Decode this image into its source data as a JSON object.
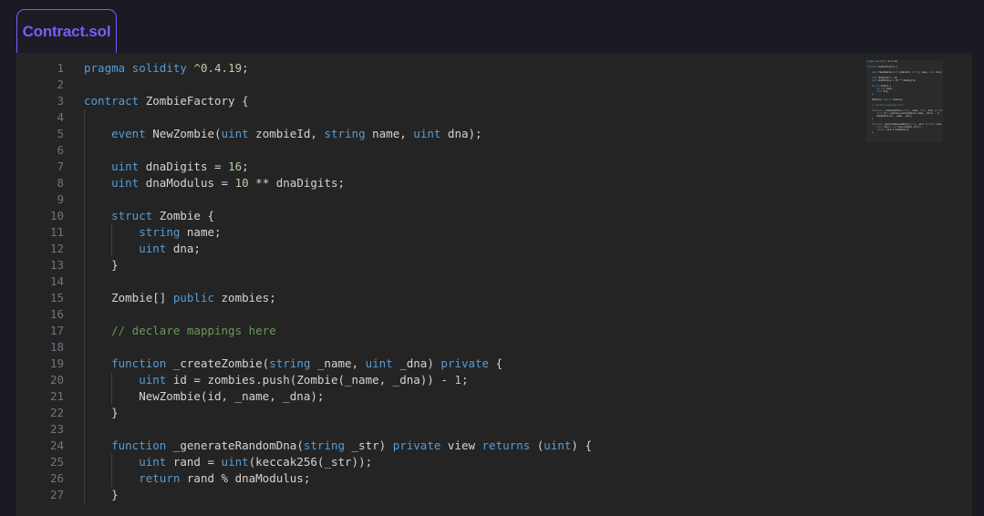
{
  "tab": {
    "label": "Contract.sol",
    "accent_color": "#7c5cfa"
  },
  "editor": {
    "background": "#242424",
    "page_background": "#1a1a22",
    "gutter_color": "#6e7681",
    "default_text_color": "#d4d4d4",
    "keyword_color": "#569cd6",
    "number_color": "#b5cea8",
    "comment_color": "#6a9955",
    "language": "solidity",
    "first_visible_line": 1,
    "last_visible_line": 27,
    "lines": [
      {
        "n": "1",
        "tokens": [
          {
            "t": "pragma",
            "c": "kw"
          },
          {
            "t": " ",
            "c": "pl"
          },
          {
            "t": "solidity",
            "c": "kw"
          },
          {
            "t": " ",
            "c": "pl"
          },
          {
            "t": "^0.4.19",
            "c": "num"
          },
          {
            "t": ";",
            "c": "pl"
          }
        ]
      },
      {
        "n": "2",
        "tokens": []
      },
      {
        "n": "3",
        "tokens": [
          {
            "t": "contract",
            "c": "kw"
          },
          {
            "t": " ZombieFactory {",
            "c": "pl"
          }
        ]
      },
      {
        "n": "4",
        "tokens": []
      },
      {
        "n": "5",
        "tokens": [
          {
            "t": "    ",
            "c": "pl"
          },
          {
            "t": "event",
            "c": "kw"
          },
          {
            "t": " NewZombie(",
            "c": "pl"
          },
          {
            "t": "uint",
            "c": "kw"
          },
          {
            "t": " zombieId, ",
            "c": "pl"
          },
          {
            "t": "string",
            "c": "kw"
          },
          {
            "t": " name, ",
            "c": "pl"
          },
          {
            "t": "uint",
            "c": "kw"
          },
          {
            "t": " dna);",
            "c": "pl"
          }
        ]
      },
      {
        "n": "6",
        "tokens": []
      },
      {
        "n": "7",
        "tokens": [
          {
            "t": "    ",
            "c": "pl"
          },
          {
            "t": "uint",
            "c": "kw"
          },
          {
            "t": " dnaDigits = ",
            "c": "pl"
          },
          {
            "t": "16",
            "c": "num"
          },
          {
            "t": ";",
            "c": "pl"
          }
        ]
      },
      {
        "n": "8",
        "tokens": [
          {
            "t": "    ",
            "c": "pl"
          },
          {
            "t": "uint",
            "c": "kw"
          },
          {
            "t": " dnaModulus = ",
            "c": "pl"
          },
          {
            "t": "10",
            "c": "num"
          },
          {
            "t": " ** dnaDigits;",
            "c": "pl"
          }
        ]
      },
      {
        "n": "9",
        "tokens": []
      },
      {
        "n": "10",
        "tokens": [
          {
            "t": "    ",
            "c": "pl"
          },
          {
            "t": "struct",
            "c": "kw"
          },
          {
            "t": " Zombie {",
            "c": "pl"
          }
        ]
      },
      {
        "n": "11",
        "tokens": [
          {
            "t": "        ",
            "c": "pl"
          },
          {
            "t": "string",
            "c": "kw"
          },
          {
            "t": " name;",
            "c": "pl"
          }
        ]
      },
      {
        "n": "12",
        "tokens": [
          {
            "t": "        ",
            "c": "pl"
          },
          {
            "t": "uint",
            "c": "kw"
          },
          {
            "t": " dna;",
            "c": "pl"
          }
        ]
      },
      {
        "n": "13",
        "tokens": [
          {
            "t": "    }",
            "c": "pl"
          }
        ]
      },
      {
        "n": "14",
        "tokens": []
      },
      {
        "n": "15",
        "tokens": [
          {
            "t": "    Zombie[] ",
            "c": "pl"
          },
          {
            "t": "public",
            "c": "kw"
          },
          {
            "t": " zombies;",
            "c": "pl"
          }
        ]
      },
      {
        "n": "16",
        "tokens": []
      },
      {
        "n": "17",
        "tokens": [
          {
            "t": "    ",
            "c": "pl"
          },
          {
            "t": "// declare mappings here",
            "c": "cmt"
          }
        ]
      },
      {
        "n": "18",
        "tokens": []
      },
      {
        "n": "19",
        "tokens": [
          {
            "t": "    ",
            "c": "pl"
          },
          {
            "t": "function",
            "c": "kw"
          },
          {
            "t": " _createZombie(",
            "c": "pl"
          },
          {
            "t": "string",
            "c": "kw"
          },
          {
            "t": " _name, ",
            "c": "pl"
          },
          {
            "t": "uint",
            "c": "kw"
          },
          {
            "t": " _dna) ",
            "c": "pl"
          },
          {
            "t": "private",
            "c": "kw"
          },
          {
            "t": " {",
            "c": "pl"
          }
        ]
      },
      {
        "n": "20",
        "tokens": [
          {
            "t": "        ",
            "c": "pl"
          },
          {
            "t": "uint",
            "c": "kw"
          },
          {
            "t": " id = zombies.push(Zombie(_name, _dna)) - ",
            "c": "pl"
          },
          {
            "t": "1",
            "c": "num"
          },
          {
            "t": ";",
            "c": "pl"
          }
        ]
      },
      {
        "n": "21",
        "tokens": [
          {
            "t": "        NewZombie(id, _name, _dna);",
            "c": "pl"
          }
        ]
      },
      {
        "n": "22",
        "tokens": [
          {
            "t": "    }",
            "c": "pl"
          }
        ]
      },
      {
        "n": "23",
        "tokens": []
      },
      {
        "n": "24",
        "tokens": [
          {
            "t": "    ",
            "c": "pl"
          },
          {
            "t": "function",
            "c": "kw"
          },
          {
            "t": " _generateRandomDna(",
            "c": "pl"
          },
          {
            "t": "string",
            "c": "kw"
          },
          {
            "t": " _str) ",
            "c": "pl"
          },
          {
            "t": "private",
            "c": "kw"
          },
          {
            "t": " view ",
            "c": "pl"
          },
          {
            "t": "returns",
            "c": "kw"
          },
          {
            "t": " (",
            "c": "pl"
          },
          {
            "t": "uint",
            "c": "kw"
          },
          {
            "t": ") {",
            "c": "pl"
          }
        ]
      },
      {
        "n": "25",
        "tokens": [
          {
            "t": "        ",
            "c": "pl"
          },
          {
            "t": "uint",
            "c": "kw"
          },
          {
            "t": " rand = ",
            "c": "pl"
          },
          {
            "t": "uint",
            "c": "kw"
          },
          {
            "t": "(keccak256(_str));",
            "c": "pl"
          }
        ]
      },
      {
        "n": "26",
        "tokens": [
          {
            "t": "        ",
            "c": "pl"
          },
          {
            "t": "return",
            "c": "kw"
          },
          {
            "t": " rand % dnaModulus;",
            "c": "pl"
          }
        ]
      },
      {
        "n": "27",
        "tokens": [
          {
            "t": "    }",
            "c": "pl"
          }
        ]
      }
    ]
  }
}
